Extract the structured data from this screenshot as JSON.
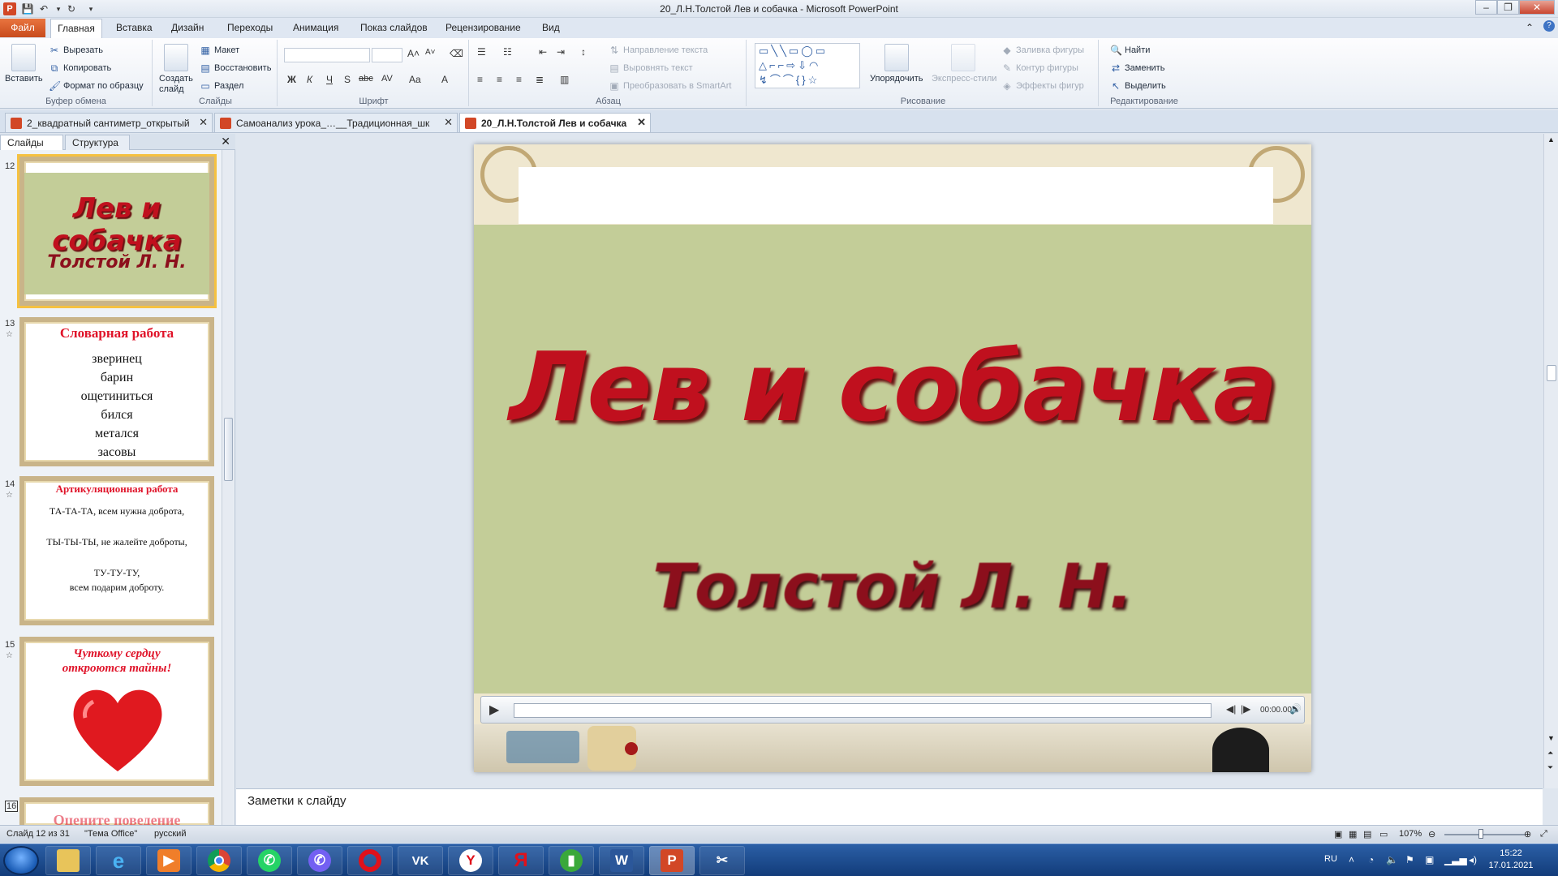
{
  "window": {
    "title": "20_Л.Н.Толстой Лев и собачка  -  Microsoft PowerPoint"
  },
  "ribbon": {
    "tabs": [
      "Файл",
      "Главная",
      "Вставка",
      "Дизайн",
      "Переходы",
      "Анимация",
      "Показ слайдов",
      "Рецензирование",
      "Вид"
    ],
    "clipboard": {
      "paste": "Вставить",
      "cut": "Вырезать",
      "copy": "Копировать",
      "format_painter": "Формат по образцу",
      "label": "Буфер обмена"
    },
    "slides": {
      "new_slide": "Создать слайд",
      "layout": "Макет",
      "reset": "Восстановить",
      "section": "Раздел",
      "label": "Слайды"
    },
    "font": {
      "label": "Шрифт",
      "bold": "Ж",
      "italic": "К",
      "underline": "Ч",
      "strike": "abc"
    },
    "paragraph": {
      "text_direction": "Направление текста",
      "align_text": "Выровнять текст",
      "smartart": "Преобразовать в SmartArt",
      "label": "Абзац"
    },
    "drawing": {
      "arrange": "Упорядочить",
      "quick_styles": "Экспресс-стили",
      "shape_fill": "Заливка фигуры",
      "shape_outline": "Контур фигуры",
      "shape_effects": "Эффекты фигур",
      "label": "Рисование"
    },
    "editing": {
      "find": "Найти",
      "replace": "Заменить",
      "select": "Выделить",
      "label": "Редактирование"
    }
  },
  "doc_tabs": [
    {
      "label": "2_квадратный сантиметр_открытый"
    },
    {
      "label": "Самоанализ урока_…__Традиционная_шк"
    },
    {
      "label": "20_Л.Н.Толстой Лев и собачка"
    }
  ],
  "panel": {
    "tab_slides": "Слайды",
    "tab_outline": "Структура",
    "thumbnails": [
      {
        "number": "12",
        "title": "Лев и собачка",
        "subtitle": "Толстой Л.  Н."
      },
      {
        "number": "13",
        "title": "Словарная   работа",
        "lines": [
          "зверинец",
          "барин",
          "ощетиниться",
          "бился",
          "метался",
          "засовы"
        ]
      },
      {
        "number": "14",
        "title": "Артикуляционная   работа",
        "lines": [
          "ТА-ТА-ТА, всем нужна доброта,",
          "ТЫ-ТЫ-ТЫ, не жалейте доброты,",
          "ТУ-ТУ-ТУ,",
          "всем подарим  доброту."
        ]
      },
      {
        "number": "15",
        "title": "Чуткому  сердцу откроются  тайны!"
      },
      {
        "number": "16",
        "title": "Оцените  поведение"
      }
    ]
  },
  "slide": {
    "title": "Лев и собачка",
    "author": "Толстой Л.  Н.",
    "media_time": "00:00.00"
  },
  "notes_placeholder": "Заметки к слайду",
  "status": {
    "slide_info": "Слайд 12 из 31",
    "theme": "\"Тема Office\"",
    "language": "русский",
    "zoom": "107%"
  },
  "taskbar": {
    "language": "RU",
    "time": "15:22",
    "date": "17.01.2021"
  }
}
